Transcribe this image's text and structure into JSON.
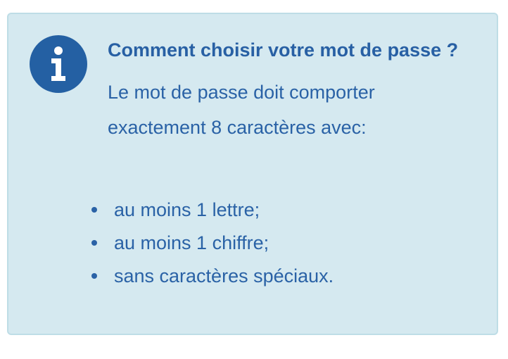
{
  "info_box": {
    "icon": "info-icon",
    "title": "Comment choisir votre mot de passe ?",
    "intro": "Le mot de passe doit comporter exactement 8 caractères avec:",
    "rules": [
      "au moins 1 lettre;",
      "au moins 1 chiffre;",
      "sans caractères spéciaux."
    ]
  },
  "colors": {
    "box_background": "#d5e9f0",
    "box_border": "#bedde6",
    "icon_circle": "#2460a3",
    "text": "#2a62a6"
  }
}
